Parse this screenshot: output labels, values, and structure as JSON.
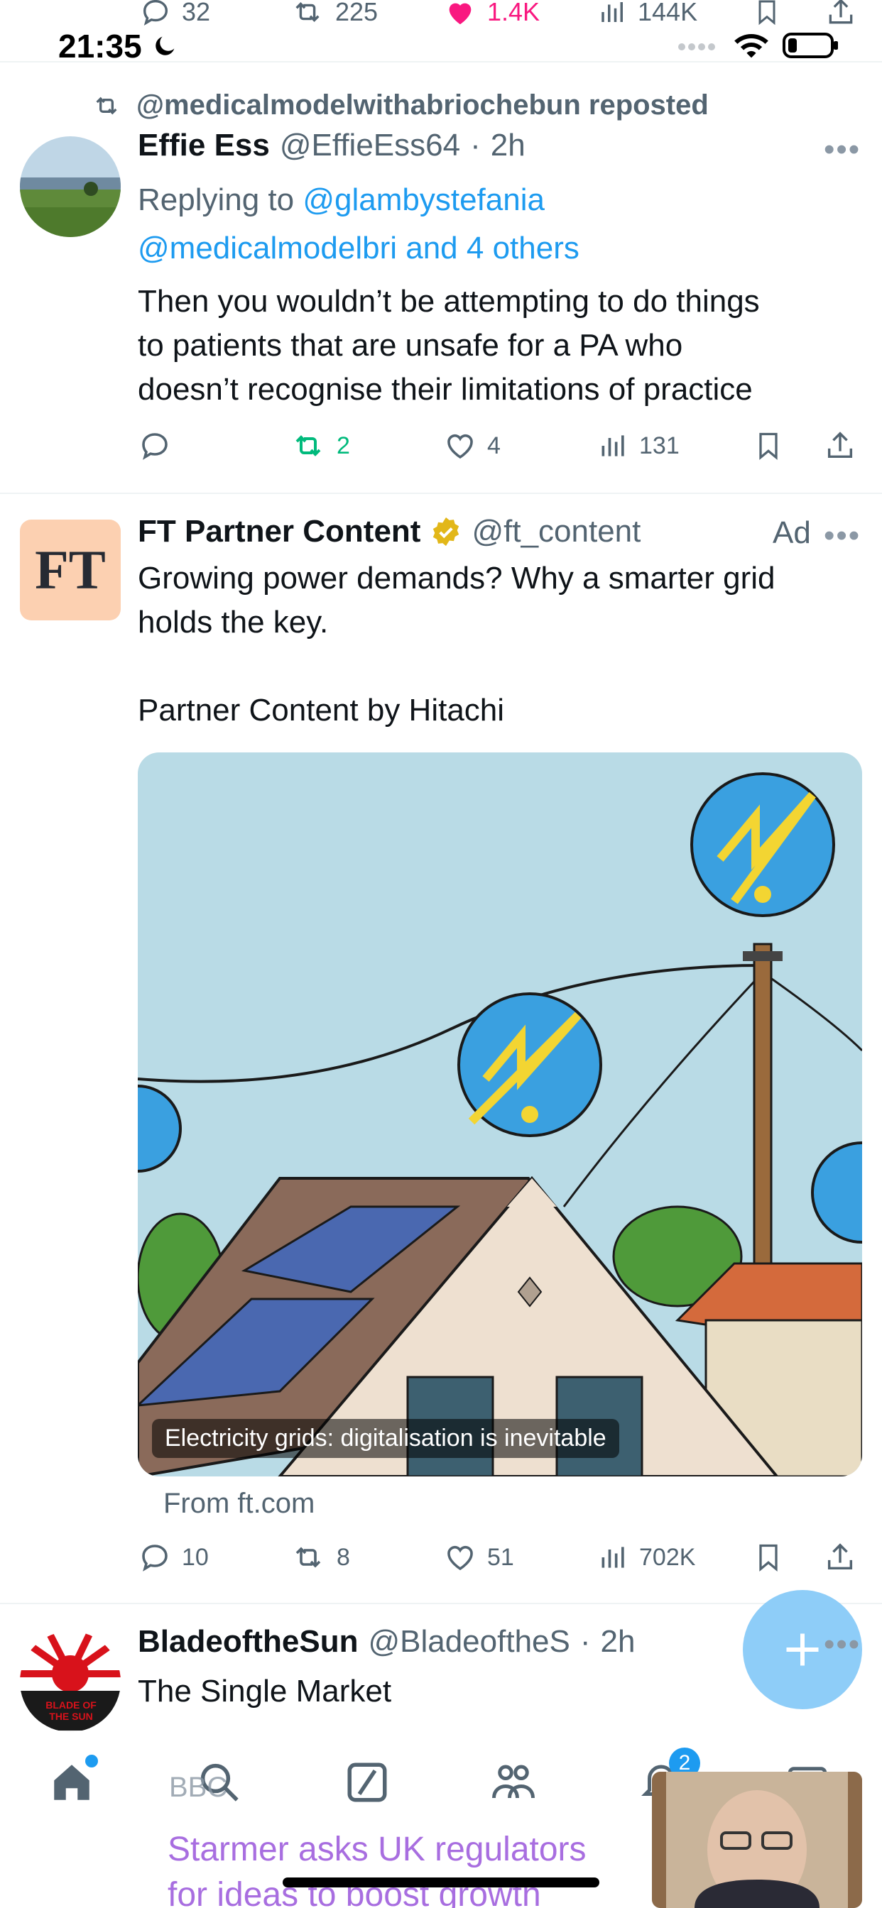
{
  "status_bar": {
    "time": "21:35"
  },
  "previous_tweet_actions": {
    "replies": "32",
    "reposts": "225",
    "likes": "1.4K",
    "views": "144K"
  },
  "tweet1": {
    "repost_banner": "@medicalmodelwithabriochebun reposted",
    "author_name": "Effie Ess",
    "handle": "@EffieEss64",
    "separator": "·",
    "time": "2h",
    "replying_prefix": "Replying to ",
    "replying_to_1": "@glambystefania",
    "replying_to_2": "@medicalmodelbri and 4 others",
    "text_line1": "Then you wouldn’t be attempting to do things",
    "text_line2": "to patients that are unsafe for a PA who",
    "text_line3": "doesn’t recognise their limitations of practice",
    "replies": "",
    "reposts": "2",
    "likes": "4",
    "views": "131",
    "colors": {
      "repost_active": "#00ba7c"
    }
  },
  "tweet2": {
    "logo_text": "FT",
    "author_name": "FT Partner Content",
    "handle": "@ft_content",
    "ad_label": "Ad",
    "text_line1": "Growing power demands? Why a smarter grid",
    "text_line2": "holds the key.",
    "text_line3": "Partner Content by Hitachi",
    "card_caption": "Electricity grids: digitalisation is inevitable",
    "card_source": "From ft.com",
    "replies": "10",
    "reposts": "8",
    "likes": "51",
    "views": "702K"
  },
  "tweet3": {
    "author_name": "BladeoftheSun",
    "handle": "@BladeoftheS",
    "separator": "·",
    "time": "2h",
    "text_line1": "The Single Market",
    "avatar_text": "BLADE OF THE SUN"
  },
  "bottom_nav": {
    "notification_badge": "2"
  },
  "pip_overlay": {
    "source": "BBC",
    "headline_line1": "Starmer asks UK regulators",
    "headline_line2": "for ideas to boost growth"
  },
  "colors": {
    "accent": "#1d9bf0",
    "like": "#f91880",
    "fab": "#8ecdf8",
    "ft_logo_bg": "#fcd0b1"
  }
}
